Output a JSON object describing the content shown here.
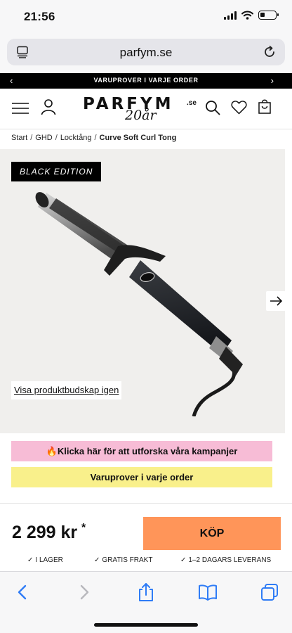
{
  "status_bar": {
    "time": "21:56"
  },
  "browser": {
    "url": "parfym.se"
  },
  "promo_bar": {
    "text": "VARUPROVER I VARJE ORDER"
  },
  "header": {
    "logo_text": "PARFYM",
    "logo_tld": ".se",
    "logo_anniversary": "20år"
  },
  "breadcrumb": {
    "items": [
      "Start",
      "GHD",
      "Locktång"
    ],
    "separator": "/",
    "current": "Curve Soft Curl Tong"
  },
  "product": {
    "badge": "BLACK EDITION",
    "reshow_link": "Visa produktbudskap igen"
  },
  "banners": {
    "campaign": "🔥Klicka här för att utforska våra kampanjer",
    "samples": "Varuprover i varje order"
  },
  "purchase": {
    "price": "2 299 kr",
    "price_marker": "*",
    "buy_label": "KÖP",
    "usps": [
      "I LAGER",
      "GRATIS FRAKT",
      "1–2 DAGARS LEVERANS"
    ]
  },
  "colors": {
    "campaign_bg": "#f7bcd6",
    "samples_bg": "#f9f08b",
    "buy_button": "#ff9559",
    "promo_bar": "#000000"
  },
  "icons": {
    "header": [
      "menu-icon",
      "user-icon",
      "search-icon",
      "heart-icon",
      "cart-icon"
    ],
    "toolbar": [
      "back-icon",
      "forward-icon",
      "share-icon",
      "bookmarks-icon",
      "tabs-icon"
    ]
  }
}
